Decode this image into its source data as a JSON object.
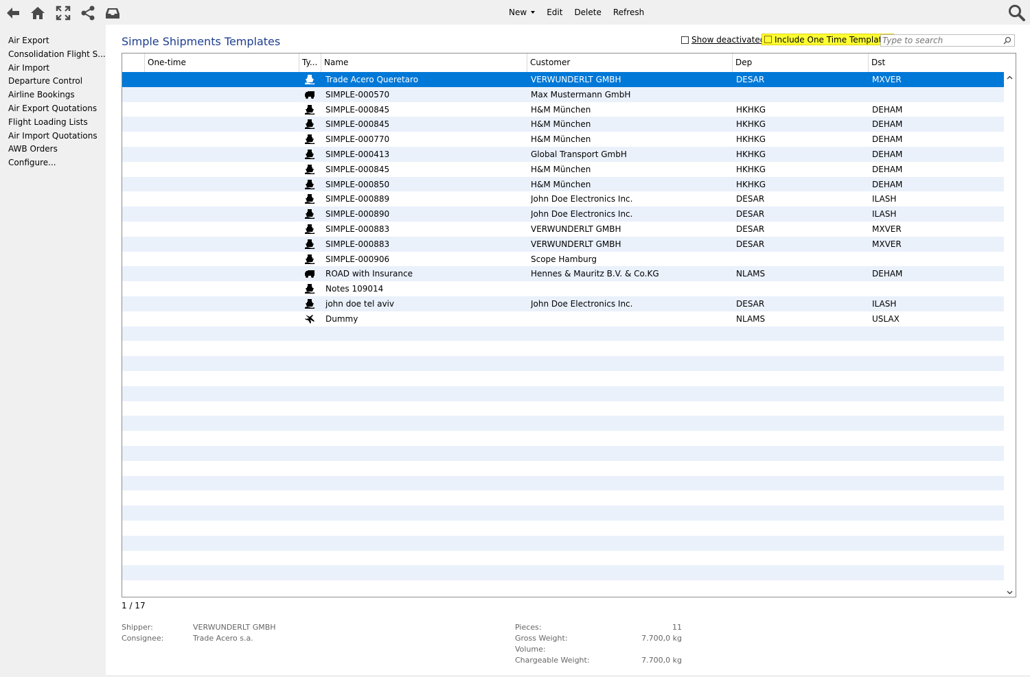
{
  "toolbar": {
    "icons": [
      "back-arrow-icon",
      "home-icon",
      "fullscreen-icon",
      "share-icon",
      "inbox-icon"
    ],
    "menu": {
      "new_label": "New",
      "edit_label": "Edit",
      "delete_label": "Delete",
      "refresh_label": "Refresh"
    }
  },
  "sidebar": {
    "items": [
      {
        "label": "Air Export"
      },
      {
        "label": "Consolidation Flight S..."
      },
      {
        "label": "Air Import"
      },
      {
        "label": "Departure Control"
      },
      {
        "label": "Airline Bookings"
      },
      {
        "label": "Air Export Quotations"
      },
      {
        "label": "Flight Loading Lists"
      },
      {
        "label": "Air Import Quotations"
      },
      {
        "label": "AWB Orders"
      },
      {
        "label": "Configure..."
      }
    ]
  },
  "main": {
    "title": "Simple Shipments Templates",
    "show_deactivated_label": "Show deactivated",
    "include_one_time_label": "Include One Time Templates",
    "search_placeholder": "Type to search",
    "colors": {
      "selected_row": "#0078d7",
      "alt_row": "#eaf1fb",
      "highlight": "#ffff33",
      "title": "#1c3d8f"
    },
    "columns": [
      "One-time",
      "Ty...",
      "Name",
      "Customer",
      "Dep",
      "Dst"
    ],
    "rows": [
      {
        "type": "ship",
        "name": "Trade Acero Queretaro",
        "customer": "VERWUNDERLT GMBH",
        "dep": "DESAR",
        "dst": "MXVER",
        "selected": true
      },
      {
        "type": "truck",
        "name": "SIMPLE-000570",
        "customer": "Max Mustermann GmbH",
        "dep": "",
        "dst": ""
      },
      {
        "type": "ship",
        "name": "SIMPLE-000845",
        "customer": "H&M München",
        "dep": "HKHKG",
        "dst": "DEHAM"
      },
      {
        "type": "ship",
        "name": "SIMPLE-000845",
        "customer": "H&M München",
        "dep": "HKHKG",
        "dst": "DEHAM"
      },
      {
        "type": "ship",
        "name": "SIMPLE-000770",
        "customer": "H&M München",
        "dep": "HKHKG",
        "dst": "DEHAM"
      },
      {
        "type": "ship",
        "name": "SIMPLE-000413",
        "customer": "Global Transport GmbH",
        "dep": "HKHKG",
        "dst": "DEHAM"
      },
      {
        "type": "ship",
        "name": "SIMPLE-000845",
        "customer": "H&M München",
        "dep": "HKHKG",
        "dst": "DEHAM"
      },
      {
        "type": "ship",
        "name": "SIMPLE-000850",
        "customer": "H&M München",
        "dep": "HKHKG",
        "dst": "DEHAM"
      },
      {
        "type": "ship",
        "name": "SIMPLE-000889",
        "customer": "John Doe Electronics Inc.",
        "dep": "DESAR",
        "dst": "ILASH"
      },
      {
        "type": "ship",
        "name": "SIMPLE-000890",
        "customer": "John Doe Electronics Inc.",
        "dep": "DESAR",
        "dst": "ILASH"
      },
      {
        "type": "ship",
        "name": "SIMPLE-000883",
        "customer": "VERWUNDERLT GMBH",
        "dep": "DESAR",
        "dst": "MXVER"
      },
      {
        "type": "ship",
        "name": "SIMPLE-000883",
        "customer": "VERWUNDERLT GMBH",
        "dep": "DESAR",
        "dst": "MXVER"
      },
      {
        "type": "ship",
        "name": "SIMPLE-000906",
        "customer": "Scope Hamburg",
        "dep": "",
        "dst": ""
      },
      {
        "type": "truck",
        "name": "ROAD with Insurance",
        "customer": "Hennes & Mauritz B.V. & Co.KG",
        "dep": "NLAMS",
        "dst": "DEHAM"
      },
      {
        "type": "ship",
        "name": "Notes 109014",
        "customer": "",
        "dep": "",
        "dst": ""
      },
      {
        "type": "ship",
        "name": "john doe tel aviv",
        "customer": "John Doe Electronics Inc.",
        "dep": "DESAR",
        "dst": "ILASH"
      },
      {
        "type": "plane",
        "name": "Dummy",
        "customer": "",
        "dep": "NLAMS",
        "dst": "USLAX"
      }
    ],
    "counter": "1 / 17"
  },
  "details": {
    "shipper_label": "Shipper:",
    "shipper_value": "VERWUNDERLT GMBH",
    "consignee_label": "Consignee:",
    "consignee_value": "Trade Acero s.a.",
    "pieces_label": "Pieces:",
    "pieces_value": "11",
    "gross_weight_label": "Gross Weight:",
    "gross_weight_value": "7.700,0 kg",
    "volume_label": "Volume:",
    "volume_value": "",
    "chargeable_weight_label": "Chargeable Weight:",
    "chargeable_weight_value": "7.700,0 kg"
  }
}
